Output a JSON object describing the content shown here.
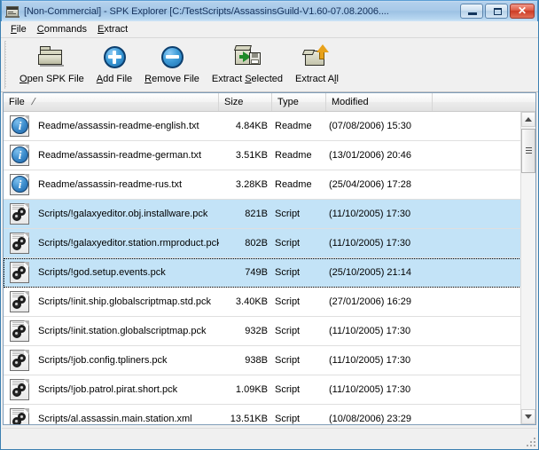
{
  "window": {
    "title": "[Non-Commercial] - SPK Explorer [C:/TestScripts/AssassinsGuild-V1.60-07.08.2006....",
    "icon": "spk-explorer-icon",
    "controls": {
      "minimize": "–",
      "maximize": "□",
      "close": "✕"
    },
    "accent_titlebar": "#a8c9e8",
    "accent_close": "#cc3c26",
    "selection_color": "#c3e3f7"
  },
  "menubar": {
    "items": [
      {
        "label": "File",
        "accel": "F"
      },
      {
        "label": "Commands",
        "accel": "C"
      },
      {
        "label": "Extract",
        "accel": "E"
      }
    ]
  },
  "toolbar": {
    "buttons": [
      {
        "label_pre": "",
        "accel": "O",
        "label_post": "pen SPK File",
        "icon": "open-folder-icon",
        "name": "open-spk-file"
      },
      {
        "label_pre": "",
        "accel": "A",
        "label_post": "dd File",
        "icon": "add-circle-icon",
        "name": "add-file"
      },
      {
        "label_pre": "",
        "accel": "R",
        "label_post": "emove File",
        "icon": "remove-circle-icon",
        "name": "remove-file"
      },
      {
        "label_pre": "Extract ",
        "accel": "S",
        "label_post": "elected",
        "icon": "extract-selected-icon",
        "name": "extract-selected"
      },
      {
        "label_pre": "Extract A",
        "accel": "l",
        "label_post": "l",
        "icon": "extract-all-icon",
        "name": "extract-all"
      }
    ]
  },
  "listview": {
    "columns": [
      {
        "label": "File",
        "sort": "/"
      },
      {
        "label": "Size",
        "sort": ""
      },
      {
        "label": "Type",
        "sort": ""
      },
      {
        "label": "Modified",
        "sort": ""
      }
    ],
    "rows": [
      {
        "icon": "info-document-icon",
        "file": "Readme/assassin-readme-english.txt",
        "size": "4.84KB",
        "type": "Readme",
        "modified": "(07/08/2006) 15:30",
        "selected": false,
        "focused": false
      },
      {
        "icon": "info-document-icon",
        "file": "Readme/assassin-readme-german.txt",
        "size": "3.51KB",
        "type": "Readme",
        "modified": "(13/01/2006) 20:46",
        "selected": false,
        "focused": false
      },
      {
        "icon": "info-document-icon",
        "file": "Readme/assassin-readme-rus.txt",
        "size": "3.28KB",
        "type": "Readme",
        "modified": "(25/04/2006) 17:28",
        "selected": false,
        "focused": false
      },
      {
        "icon": "script-document-icon",
        "file": "Scripts/!galaxyeditor.obj.installware.pck",
        "size": "821B",
        "type": "Script",
        "modified": "(11/10/2005) 17:30",
        "selected": true,
        "focused": false
      },
      {
        "icon": "script-document-icon",
        "file": "Scripts/!galaxyeditor.station.rmproduct.pck",
        "size": "802B",
        "type": "Script",
        "modified": "(11/10/2005) 17:30",
        "selected": true,
        "focused": false
      },
      {
        "icon": "script-document-icon",
        "file": "Scripts/!god.setup.events.pck",
        "size": "749B",
        "type": "Script",
        "modified": "(25/10/2005) 21:14",
        "selected": true,
        "focused": true
      },
      {
        "icon": "script-document-icon",
        "file": "Scripts/!init.ship.globalscriptmap.std.pck",
        "size": "3.40KB",
        "type": "Script",
        "modified": "(27/01/2006) 16:29",
        "selected": false,
        "focused": false
      },
      {
        "icon": "script-document-icon",
        "file": "Scripts/!init.station.globalscriptmap.pck",
        "size": "932B",
        "type": "Script",
        "modified": "(11/10/2005) 17:30",
        "selected": false,
        "focused": false
      },
      {
        "icon": "script-document-icon",
        "file": "Scripts/!job.config.tpliners.pck",
        "size": "938B",
        "type": "Script",
        "modified": "(11/10/2005) 17:30",
        "selected": false,
        "focused": false
      },
      {
        "icon": "script-document-icon",
        "file": "Scripts/!job.patrol.pirat.short.pck",
        "size": "1.09KB",
        "type": "Script",
        "modified": "(11/10/2005) 17:30",
        "selected": false,
        "focused": false
      },
      {
        "icon": "script-document-icon",
        "file": "Scripts/al.assassin.main.station.xml",
        "size": "13.51KB",
        "type": "Script",
        "modified": "(10/08/2006) 23:29",
        "selected": false,
        "focused": false
      }
    ]
  },
  "scrollbar": {
    "up_arrow": "scroll-up-icon",
    "down_arrow": "scroll-down-icon"
  },
  "statusbar": {
    "text": ""
  }
}
